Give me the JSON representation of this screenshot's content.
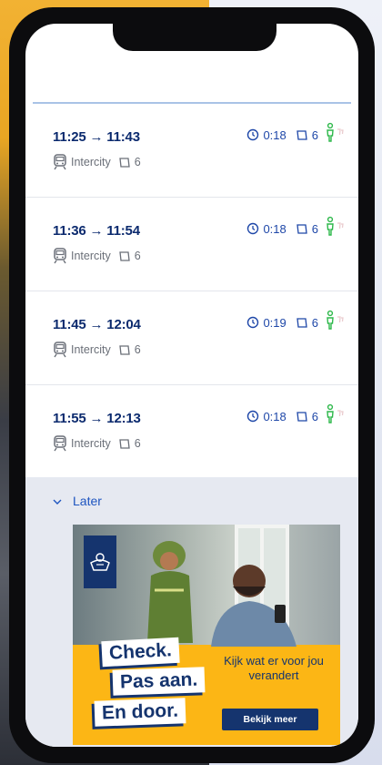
{
  "trips": [
    {
      "depart": "11:25",
      "arrive": "11:43",
      "train_type": "Intercity",
      "platform": "6",
      "duration": "0:18",
      "transfer_platform": "6"
    },
    {
      "depart": "11:36",
      "arrive": "11:54",
      "train_type": "Intercity",
      "platform": "6",
      "duration": "0:18",
      "transfer_platform": "6"
    },
    {
      "depart": "11:45",
      "arrive": "12:04",
      "train_type": "Intercity",
      "platform": "6",
      "duration": "0:19",
      "transfer_platform": "6"
    },
    {
      "depart": "11:55",
      "arrive": "12:13",
      "train_type": "Intercity",
      "platform": "6",
      "duration": "0:18",
      "transfer_platform": "6"
    }
  ],
  "arrow": "→",
  "later_label": "Later",
  "ad": {
    "headline_1": "Check.",
    "headline_2": "Pas aan.",
    "headline_3": "En door.",
    "subtext": "Kijk wat er voor jou verandert",
    "cta": "Bekijk meer"
  },
  "icons": {
    "train": "train-icon",
    "platform": "platform-icon",
    "clock": "clock-icon",
    "crowd": "person-icon",
    "chevron": "chevron-down-icon",
    "crest": "government-crest-icon"
  },
  "colors": {
    "time_text": "#0b2a6e",
    "info_blue": "#1e47a8",
    "crowd_green": "#2db84a",
    "ad_yellow": "#fcb615",
    "ad_navy": "#15346e"
  }
}
